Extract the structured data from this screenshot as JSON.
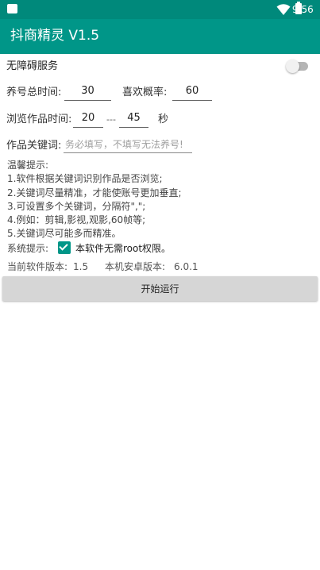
{
  "status_bar": {
    "time": "9:56"
  },
  "app_bar": {
    "title": "抖商精灵 V1.5"
  },
  "accessibility": {
    "label": "无障碍服务",
    "enabled": false
  },
  "settings": {
    "raise_time_label": "养号总时间:",
    "raise_time_value": "30",
    "like_rate_label": "喜欢概率:",
    "like_rate_value": "60",
    "browse_time_label": "浏览作品时间:",
    "browse_min": "20",
    "range_separator": "---",
    "browse_max": "45",
    "browse_unit": "秒",
    "keyword_label": "作品关键词:",
    "keyword_value": "",
    "keyword_placeholder": "务必填写，不填写无法养号!"
  },
  "tips": {
    "title": "温馨提示:",
    "lines": [
      "1.软件根据关键词识别作品是否浏览;",
      "2.关键词尽量精准，才能使账号更加垂直;",
      "3.可设置多个关键词，分隔符\",\";",
      "4.例如：剪辑,影视,观影,60帧等;",
      "5.关键词尽可能多而精准。"
    ]
  },
  "system_tip": {
    "label": "系统提示:",
    "checked": true,
    "text": "本软件无需root权限。"
  },
  "versions": {
    "app_label": "当前软件版本:",
    "app_value": "1.5",
    "android_label": "本机安卓版本:",
    "android_value": "6.0.1"
  },
  "start_button": {
    "label": "开始运行"
  },
  "colors": {
    "primary": "#009688",
    "primary_dark": "#00897b",
    "button_bg": "#d6d6d6"
  }
}
